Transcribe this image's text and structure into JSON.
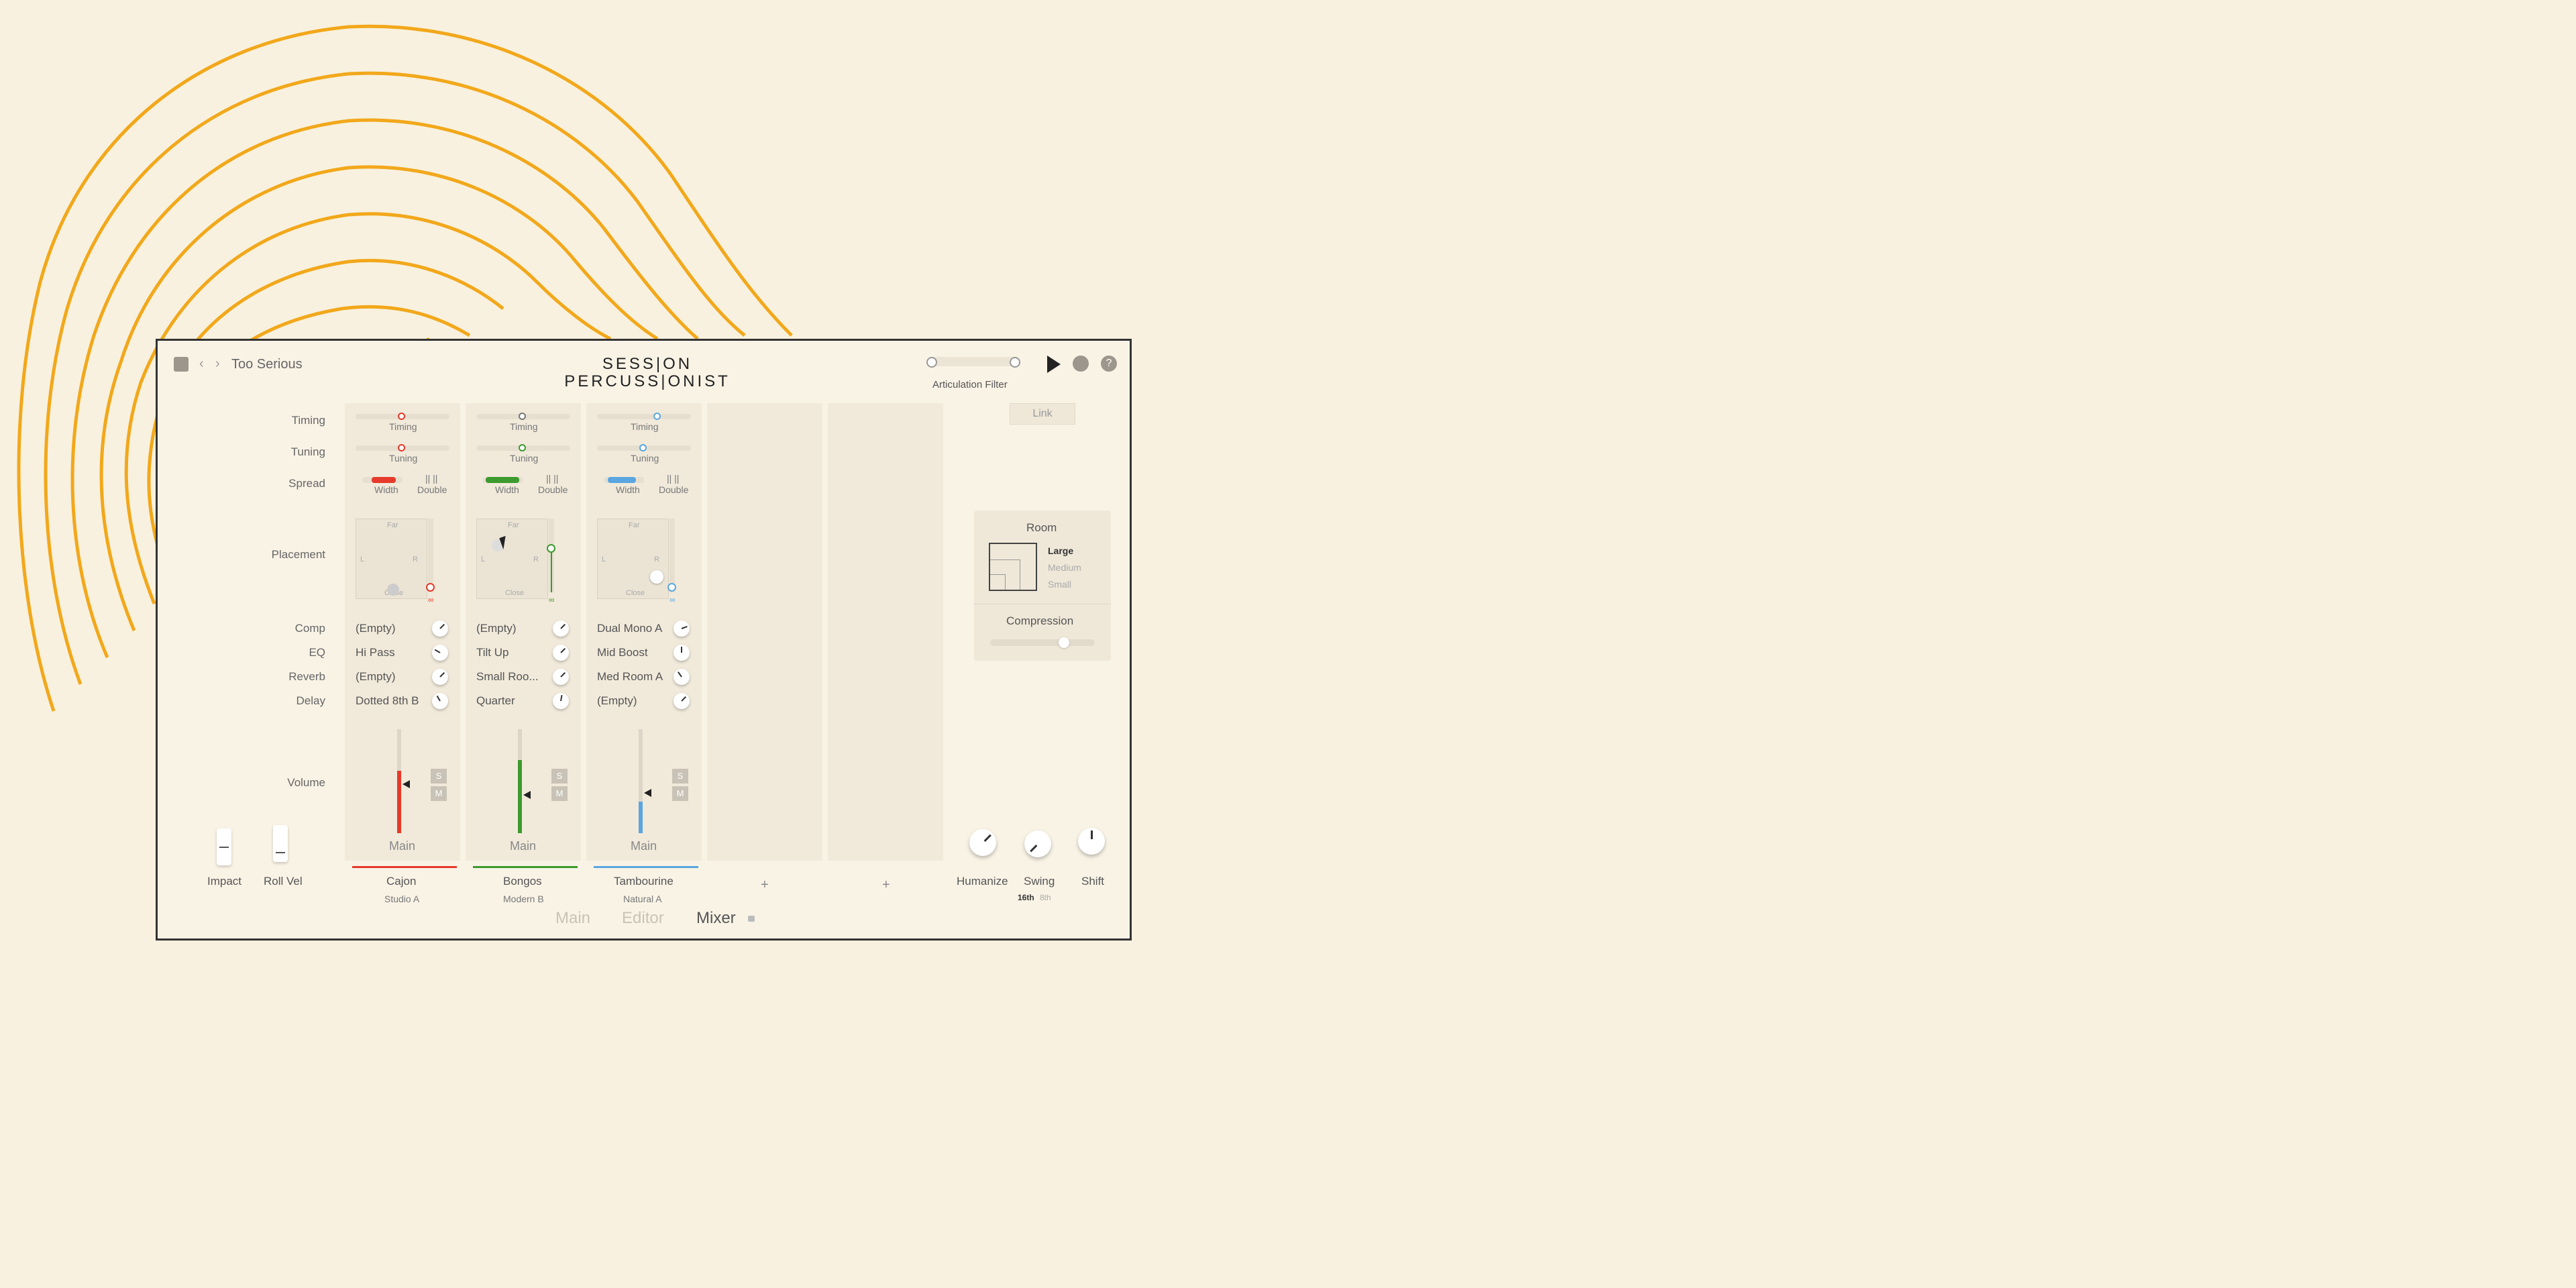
{
  "colors": {
    "cajon": "#e63a2a",
    "bongos": "#3d9a2e",
    "tambourine": "#5aa6e0",
    "art": "#f2a81b"
  },
  "header": {
    "preset_name": "Too Serious",
    "logo_line1": "SESS|ON",
    "logo_line2": "PERCUSS|ONIST",
    "articulation_filter": "Articulation Filter"
  },
  "row_labels": {
    "timing": "Timing",
    "tuning": "Tuning",
    "spread": "Spread",
    "placement": "Placement",
    "comp": "Comp",
    "eq": "EQ",
    "reverb": "Reverb",
    "delay": "Delay",
    "volume": "Volume"
  },
  "channels": [
    {
      "timing": "Timing",
      "tuning": "Tuning",
      "width": "Width",
      "double": "Double",
      "far": "Far",
      "close": "Close",
      "l": "L",
      "r": "R",
      "comp": "(Empty)",
      "eq": "Hi Pass",
      "reverb": "(Empty)",
      "delay": "Dotted 8th B",
      "solo": "S",
      "mute": "M",
      "output": "Main",
      "instrument": "Cajon",
      "kit": "Studio A",
      "volume": 0.6
    },
    {
      "timing": "Timing",
      "tuning": "Tuning",
      "width": "Width",
      "double": "Double",
      "far": "Far",
      "close": "Close",
      "l": "L",
      "r": "R",
      "comp": "(Empty)",
      "eq": "Tilt Up",
      "reverb": "Small Roo...",
      "delay": "Quarter",
      "solo": "S",
      "mute": "M",
      "output": "Main",
      "instrument": "Bongos",
      "kit": "Modern B",
      "volume": 0.7
    },
    {
      "timing": "Timing",
      "tuning": "Tuning",
      "width": "Width",
      "double": "Double",
      "far": "Far",
      "close": "Close",
      "l": "L",
      "r": "R",
      "comp": "Dual Mono A",
      "eq": "Mid Boost",
      "reverb": "Med Room A",
      "delay": "(Empty)",
      "solo": "S",
      "mute": "M",
      "output": "Main",
      "instrument": "Tambourine",
      "kit": "Natural A",
      "volume": 0.3
    }
  ],
  "empty_slots": [
    "+",
    "+"
  ],
  "right_panel": {
    "link": "Link",
    "room": "Room",
    "room_options": [
      "Large",
      "Medium",
      "Small"
    ],
    "compression": "Compression"
  },
  "bottom": {
    "impact": "Impact",
    "roll_vel": "Roll Vel",
    "humanize": "Humanize",
    "swing": "Swing",
    "swing_16th": "16th",
    "swing_8th": "8th",
    "shift": "Shift"
  },
  "tabs": [
    "Main",
    "Editor",
    "Mixer"
  ]
}
